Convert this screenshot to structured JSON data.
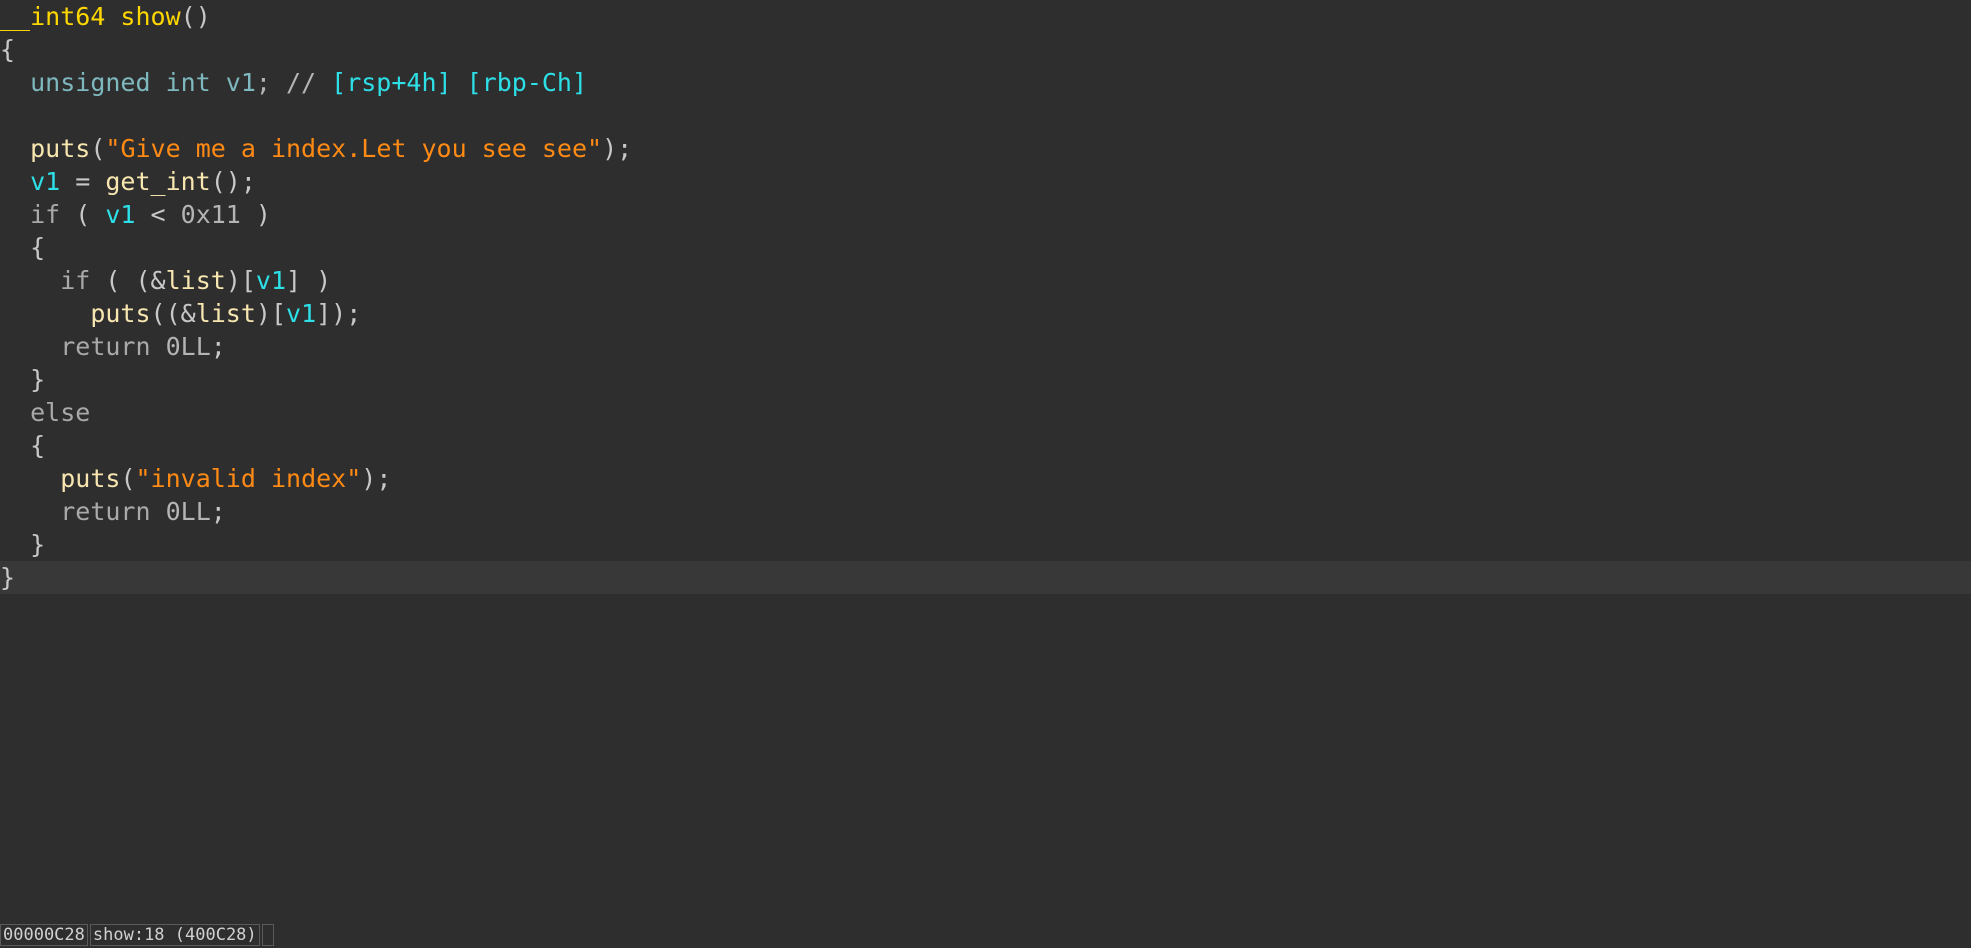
{
  "editor": {
    "lines": [
      {
        "tokens": [
          {
            "t": "__int64 ",
            "c": "type"
          },
          {
            "t": "show",
            "c": "type"
          },
          {
            "t": "()",
            "c": "punc"
          }
        ]
      },
      {
        "tokens": [
          {
            "t": "{",
            "c": "punc"
          }
        ]
      },
      {
        "tokens": [
          {
            "t": "  ",
            "c": "plain"
          },
          {
            "t": "unsigned int ",
            "c": "decl"
          },
          {
            "t": "v1",
            "c": "decl"
          },
          {
            "t": "; // ",
            "c": "cmt"
          },
          {
            "t": "[rsp+4h] [rbp-Ch]",
            "c": "reg"
          }
        ]
      },
      {
        "tokens": [
          {
            "t": "",
            "c": "plain"
          }
        ]
      },
      {
        "tokens": [
          {
            "t": "  ",
            "c": "plain"
          },
          {
            "t": "puts",
            "c": "func"
          },
          {
            "t": "(",
            "c": "punc"
          },
          {
            "t": "\"Give me a index.Let you see see\"",
            "c": "str"
          },
          {
            "t": ");",
            "c": "punc"
          }
        ]
      },
      {
        "tokens": [
          {
            "t": "  ",
            "c": "plain"
          },
          {
            "t": "v1",
            "c": "var"
          },
          {
            "t": " = ",
            "c": "punc"
          },
          {
            "t": "get_int",
            "c": "func"
          },
          {
            "t": "();",
            "c": "punc"
          }
        ]
      },
      {
        "tokens": [
          {
            "t": "  ",
            "c": "plain"
          },
          {
            "t": "if",
            "c": "kw"
          },
          {
            "t": " ( ",
            "c": "punc"
          },
          {
            "t": "v1",
            "c": "var"
          },
          {
            "t": " < ",
            "c": "punc"
          },
          {
            "t": "0x11",
            "c": "num"
          },
          {
            "t": " )",
            "c": "punc"
          }
        ]
      },
      {
        "tokens": [
          {
            "t": "  {",
            "c": "punc"
          }
        ]
      },
      {
        "tokens": [
          {
            "t": "    ",
            "c": "plain"
          },
          {
            "t": "if",
            "c": "kw"
          },
          {
            "t": " ( (&",
            "c": "punc"
          },
          {
            "t": "list",
            "c": "func"
          },
          {
            "t": ")[",
            "c": "punc"
          },
          {
            "t": "v1",
            "c": "var"
          },
          {
            "t": "] )",
            "c": "punc"
          }
        ]
      },
      {
        "tokens": [
          {
            "t": "      ",
            "c": "plain"
          },
          {
            "t": "puts",
            "c": "func"
          },
          {
            "t": "((&",
            "c": "punc"
          },
          {
            "t": "list",
            "c": "func"
          },
          {
            "t": ")[",
            "c": "punc"
          },
          {
            "t": "v1",
            "c": "var"
          },
          {
            "t": "]);",
            "c": "punc"
          }
        ]
      },
      {
        "tokens": [
          {
            "t": "    ",
            "c": "plain"
          },
          {
            "t": "return",
            "c": "kw"
          },
          {
            "t": " ",
            "c": "plain"
          },
          {
            "t": "0LL",
            "c": "num"
          },
          {
            "t": ";",
            "c": "punc"
          }
        ]
      },
      {
        "tokens": [
          {
            "t": "  }",
            "c": "punc"
          }
        ]
      },
      {
        "tokens": [
          {
            "t": "  ",
            "c": "plain"
          },
          {
            "t": "else",
            "c": "kw"
          }
        ]
      },
      {
        "tokens": [
          {
            "t": "  {",
            "c": "punc"
          }
        ]
      },
      {
        "tokens": [
          {
            "t": "    ",
            "c": "plain"
          },
          {
            "t": "puts",
            "c": "func"
          },
          {
            "t": "(",
            "c": "punc"
          },
          {
            "t": "\"invalid index\"",
            "c": "str"
          },
          {
            "t": ");",
            "c": "punc"
          }
        ]
      },
      {
        "tokens": [
          {
            "t": "    ",
            "c": "plain"
          },
          {
            "t": "return",
            "c": "kw"
          },
          {
            "t": " ",
            "c": "plain"
          },
          {
            "t": "0LL",
            "c": "num"
          },
          {
            "t": ";",
            "c": "punc"
          }
        ]
      },
      {
        "tokens": [
          {
            "t": "  }",
            "c": "punc"
          }
        ]
      },
      {
        "tokens": [
          {
            "t": "}",
            "c": "punc"
          }
        ],
        "current": true
      }
    ]
  },
  "statusbar": {
    "address": "00000C28",
    "location": "show:18 (400C28)"
  },
  "colors": {
    "background": "#2e2e2e",
    "current_line": "#383838",
    "type": "#ffd700",
    "function": "#f8e6b0",
    "variable": "#2de0e8",
    "string": "#ff8a14",
    "keyword": "#a9a9a9"
  }
}
